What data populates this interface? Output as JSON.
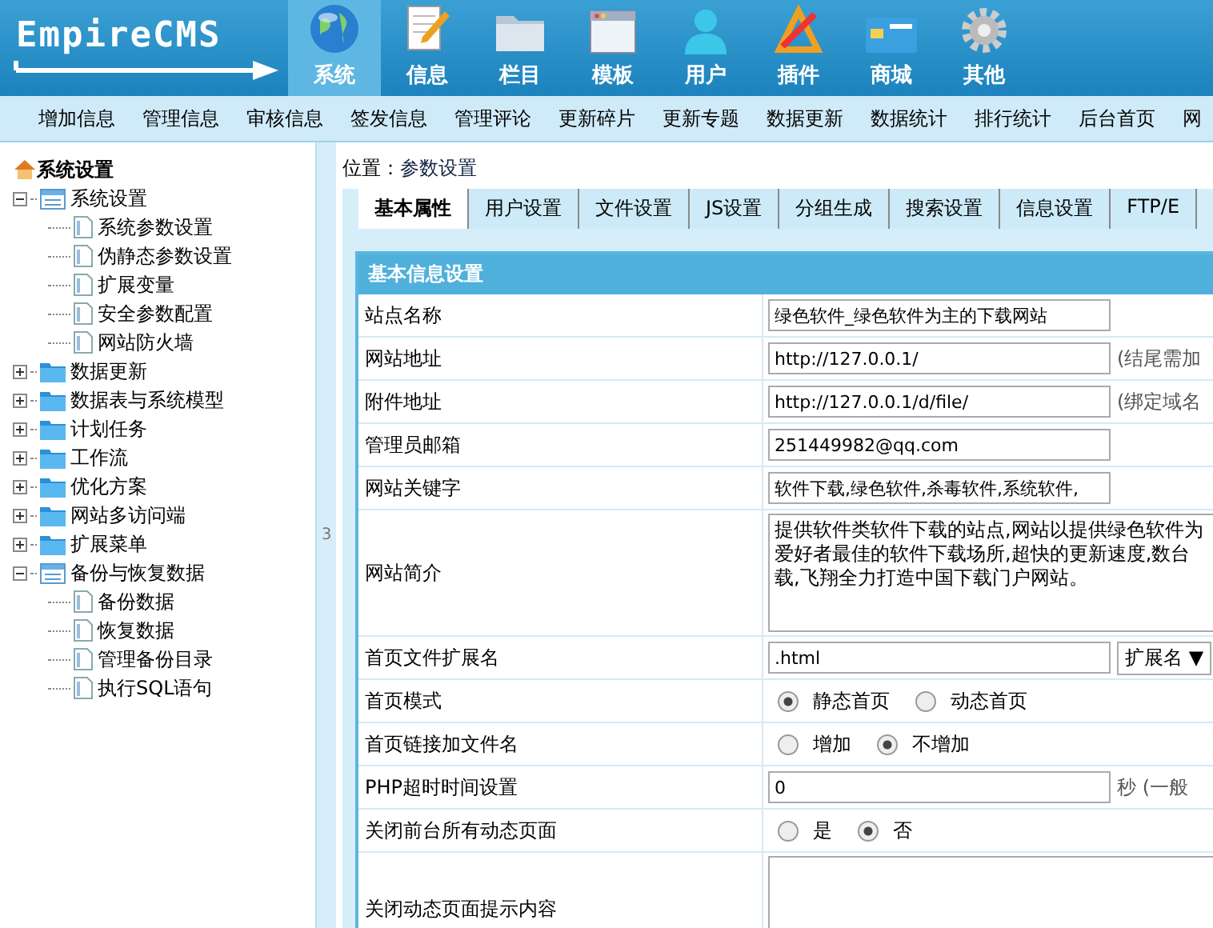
{
  "logo": {
    "text": "EmpireCMS"
  },
  "nav": [
    {
      "label": "系统",
      "selected": true
    },
    {
      "label": "信息",
      "selected": false
    },
    {
      "label": "栏目",
      "selected": false
    },
    {
      "label": "模板",
      "selected": false
    },
    {
      "label": "用户",
      "selected": false
    },
    {
      "label": "插件",
      "selected": false
    },
    {
      "label": "商城",
      "selected": false
    },
    {
      "label": "其他",
      "selected": false
    }
  ],
  "submenu": [
    "增加信息",
    "管理信息",
    "审核信息",
    "签发信息",
    "管理评论",
    "更新碎片",
    "更新专题",
    "数据更新",
    "数据统计",
    "排行统计",
    "后台首页",
    "网"
  ],
  "sidebar": {
    "title": "系统设置",
    "tree": [
      {
        "label": "系统设置",
        "expanded": true,
        "children": [
          {
            "label": "系统参数设置"
          },
          {
            "label": "伪静态参数设置"
          },
          {
            "label": "扩展变量"
          },
          {
            "label": "安全参数配置"
          },
          {
            "label": "网站防火墙"
          }
        ]
      },
      {
        "label": "数据更新",
        "expanded": false
      },
      {
        "label": "数据表与系统模型",
        "expanded": false
      },
      {
        "label": "计划任务",
        "expanded": false
      },
      {
        "label": "工作流",
        "expanded": false
      },
      {
        "label": "优化方案",
        "expanded": false
      },
      {
        "label": "网站多访问端",
        "expanded": false
      },
      {
        "label": "扩展菜单",
        "expanded": false
      },
      {
        "label": "备份与恢复数据",
        "expanded": true,
        "children": [
          {
            "label": "备份数据"
          },
          {
            "label": "恢复数据"
          },
          {
            "label": "管理备份目录"
          },
          {
            "label": "执行SQL语句"
          }
        ]
      }
    ]
  },
  "splitter": {
    "text": "3"
  },
  "breadcrumb": {
    "label": "位置：",
    "link": "参数设置"
  },
  "tabs": [
    {
      "label": "基本属性",
      "selected": true
    },
    {
      "label": "用户设置",
      "selected": false
    },
    {
      "label": "文件设置",
      "selected": false
    },
    {
      "label": "JS设置",
      "selected": false
    },
    {
      "label": "分组生成",
      "selected": false
    },
    {
      "label": "搜索设置",
      "selected": false
    },
    {
      "label": "信息设置",
      "selected": false
    },
    {
      "label": "FTP/E",
      "selected": false
    }
  ],
  "form": {
    "title": "基本信息设置",
    "rows": [
      {
        "kind": "text",
        "label": "站点名称",
        "value": "绿色软件_绿色软件为主的下载网站"
      },
      {
        "kind": "text",
        "label": "网站地址",
        "value": "http://127.0.0.1/",
        "note": "(结尾需加"
      },
      {
        "kind": "text",
        "label": "附件地址",
        "value": "http://127.0.0.1/d/file/",
        "note": "(绑定域名"
      },
      {
        "kind": "text",
        "label": "管理员邮箱",
        "value": "251449982@qq.com"
      },
      {
        "kind": "text",
        "label": "网站关键字",
        "value": "软件下载,绿色软件,杀毒软件,系统软件,"
      },
      {
        "kind": "textarea",
        "label": "网站简介",
        "lines": [
          "提供软件类软件下载的站点,网站以提供绿色软件为",
          "爱好者最佳的软件下载场所,超快的更新速度,数台",
          "载,飞翔全力打造中国下载门户网站。"
        ]
      },
      {
        "kind": "select",
        "label": "首页文件扩展名",
        "value": ".html",
        "select": "扩展名 ▼"
      },
      {
        "kind": "radio",
        "label": "首页模式",
        "options": [
          {
            "label": "静态首页",
            "selected": true
          },
          {
            "label": "动态首页",
            "selected": false
          }
        ]
      },
      {
        "kind": "radio",
        "label": "首页链接加文件名",
        "options": [
          {
            "label": "增加",
            "selected": false
          },
          {
            "label": "不增加",
            "selected": true
          }
        ]
      },
      {
        "kind": "text",
        "label": "PHP超时时间设置",
        "value": "0",
        "note": "秒 (一般"
      },
      {
        "kind": "radio",
        "label": "关闭前台所有动态页面",
        "options": [
          {
            "label": "是",
            "selected": false
          },
          {
            "label": "否",
            "selected": true
          }
        ]
      },
      {
        "kind": "textarea",
        "label": "关闭动态页面提示内容"
      }
    ]
  }
}
